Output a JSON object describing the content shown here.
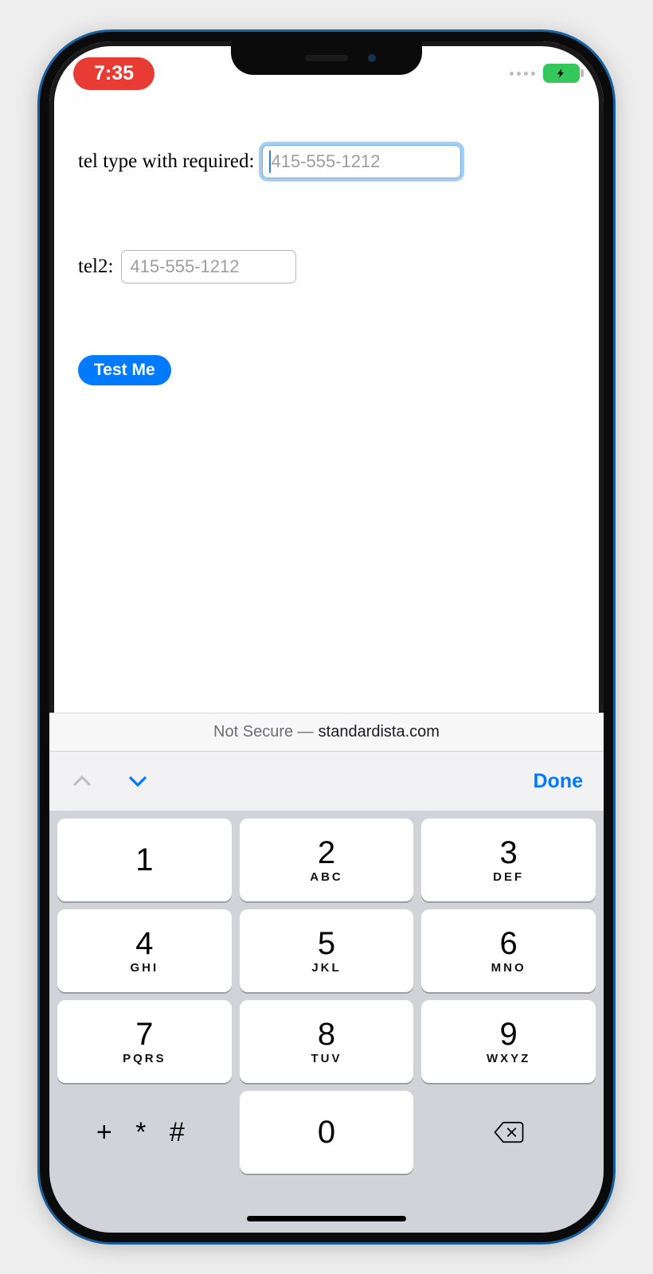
{
  "status": {
    "time": "7:35"
  },
  "form": {
    "label1": "tel type with required:",
    "placeholder1": "415-555-1212",
    "label2": "tel2:",
    "placeholder2": "415-555-1212",
    "button": "Test Me"
  },
  "address": {
    "prefix": "Not Secure —",
    "host": "standardista.com"
  },
  "accessory": {
    "done": "Done"
  },
  "keys": {
    "k1": "1",
    "k2": "2",
    "k2s": "ABC",
    "k3": "3",
    "k3s": "DEF",
    "k4": "4",
    "k4s": "GHI",
    "k5": "5",
    "k5s": "JKL",
    "k6": "6",
    "k6s": "MNO",
    "k7": "7",
    "k7s": "PQRS",
    "k8": "8",
    "k8s": "TUV",
    "k9": "9",
    "k9s": "WXYZ",
    "ksym": "+ * #",
    "k0": "0"
  }
}
